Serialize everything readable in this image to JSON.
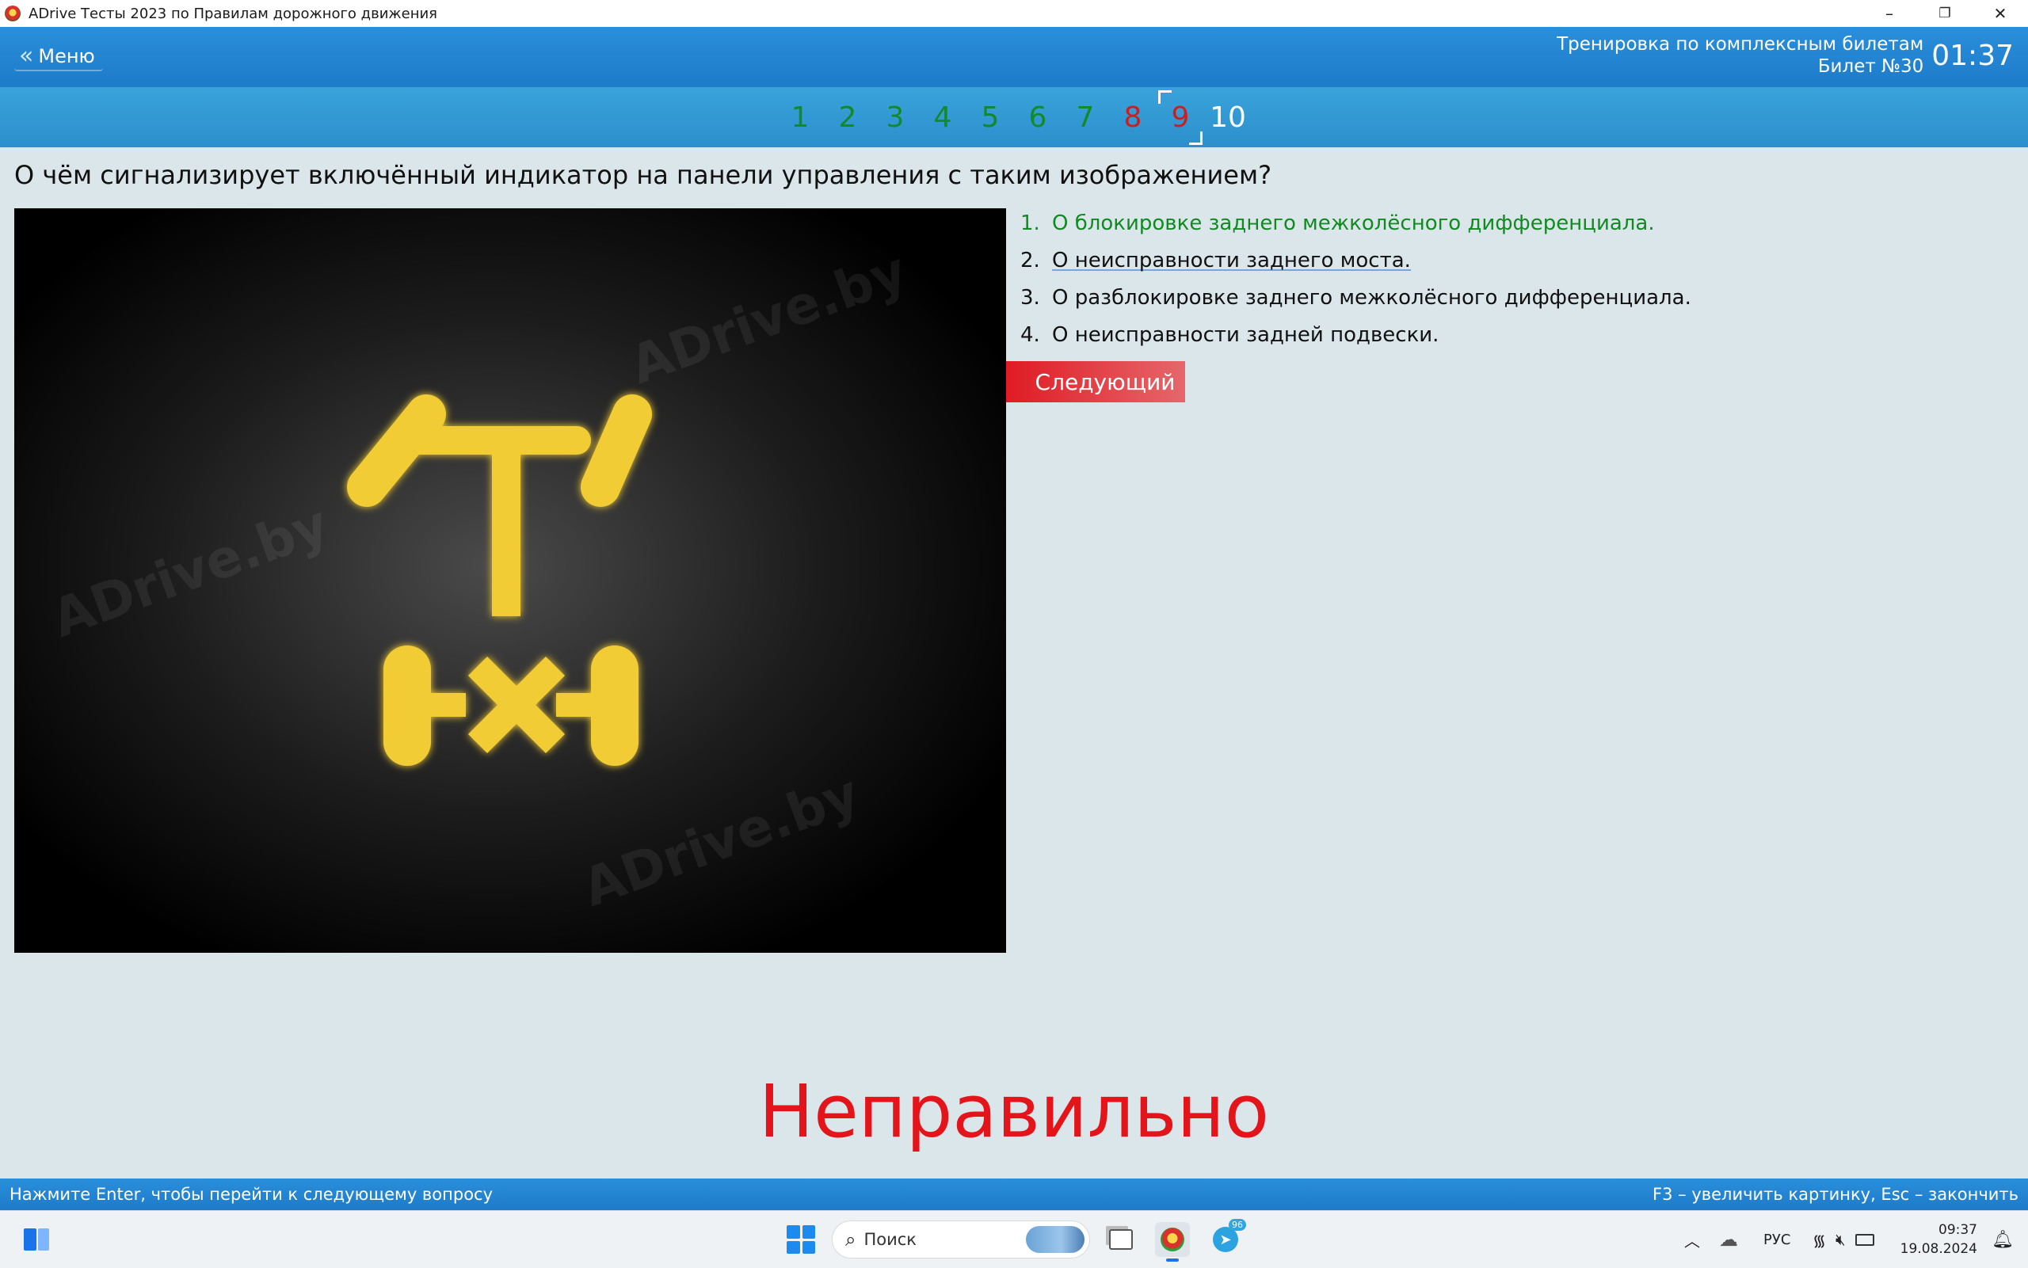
{
  "window": {
    "title": "ADrive Тесты 2023 по Правилам дорожного движения",
    "controls": {
      "minimize": "–",
      "restore": "❐",
      "close": "✕"
    }
  },
  "header": {
    "menu_label": "Меню",
    "mode": "Тренировка по комплексным билетам",
    "ticket": "Билет №30",
    "timer": "01:37"
  },
  "question_nav": {
    "items": [
      {
        "label": "1",
        "state": "ok"
      },
      {
        "label": "2",
        "state": "ok"
      },
      {
        "label": "3",
        "state": "ok"
      },
      {
        "label": "4",
        "state": "ok"
      },
      {
        "label": "5",
        "state": "ok"
      },
      {
        "label": "6",
        "state": "ok"
      },
      {
        "label": "7",
        "state": "ok"
      },
      {
        "label": "8",
        "state": "bad"
      },
      {
        "label": "9",
        "state": "bad current"
      },
      {
        "label": "10",
        "state": "pending"
      }
    ]
  },
  "question": {
    "text": "О чём сигнализирует включённый индикатор на панели управления с таким изображением?",
    "image_watermark": "ADrive.by",
    "indicator_color": "#f2cc35"
  },
  "answers": [
    {
      "index": "1.",
      "text": "О блокировке заднего межколёсного дифференциала.",
      "state": "correct"
    },
    {
      "index": "2.",
      "text": "О неисправности заднего моста.",
      "state": "selected"
    },
    {
      "index": "3.",
      "text": "О разблокировке заднего межколёсного дифференциала.",
      "state": ""
    },
    {
      "index": "4.",
      "text": "О неисправности задней подвески.",
      "state": ""
    }
  ],
  "next_button": "Следующий",
  "verdict": "Неправильно",
  "statusbar": {
    "left": "Нажмите Enter, чтобы перейти к следующему вопросу",
    "right": "F3 – увеличить картинку, Esc – закончить"
  },
  "taskbar": {
    "search_label": "Поиск",
    "language": "РУС",
    "time": "09:37",
    "date": "19.08.2024",
    "telegram_badge": "96"
  },
  "colors": {
    "header_blue": "#1d7bc9",
    "correct_green": "#118a22",
    "wrong_red": "#e4141b"
  }
}
